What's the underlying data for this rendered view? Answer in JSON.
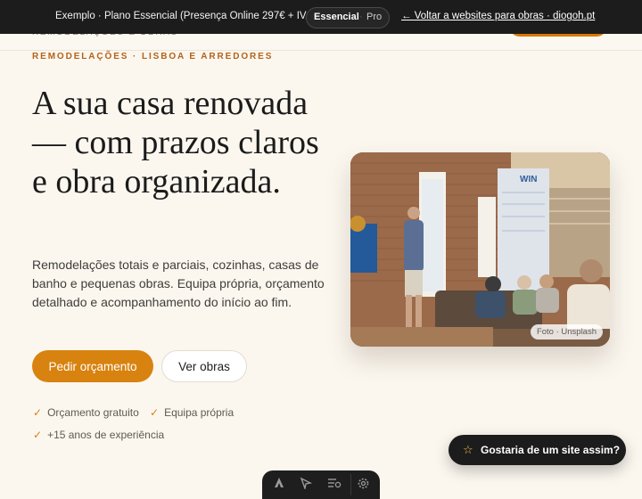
{
  "demo_bar": {
    "text": "Exemplo · Plano Essencial (Presença Online 297€ + IVA)",
    "plan_options": [
      "Essencial",
      "Pro"
    ],
    "plan_separator": "·",
    "selected_plan": "Essencial",
    "back_link": "← Voltar a websites para obras · diogoh.pt"
  },
  "site_header": {
    "brand": "REMODELAÇÕES & OBRAS"
  },
  "hero": {
    "kicker": "REMODELAÇÕES · LISBOA E ARREDORES",
    "title": "A sua casa renovada — com prazos claros e obra organizada.",
    "description": "Remodelações totais e parciais, cozinhas, casas de banho e pequenas obras. Equipa própria, orçamento detalhado e acompanhamento do início ao fim.",
    "primary_button": "Pedir orçamento",
    "secondary_button": "Ver obras",
    "features": [
      "Orçamento gratuito",
      "Equipa própria",
      "+15 anos de experiência"
    ],
    "check_glyph": "✓",
    "image_credit": "Foto · Unsplash"
  },
  "floating_cta": {
    "label": "Gostaria de um site assim?",
    "icon": "star-icon"
  },
  "toolbar": {
    "icons": [
      "astro-logo-icon",
      "cursor-icon",
      "audit-icon",
      "gear-icon"
    ]
  },
  "colors": {
    "accent": "#d8820f",
    "background": "#fbf7ef",
    "dark": "#1c1c1c",
    "kicker": "#b4621b"
  }
}
